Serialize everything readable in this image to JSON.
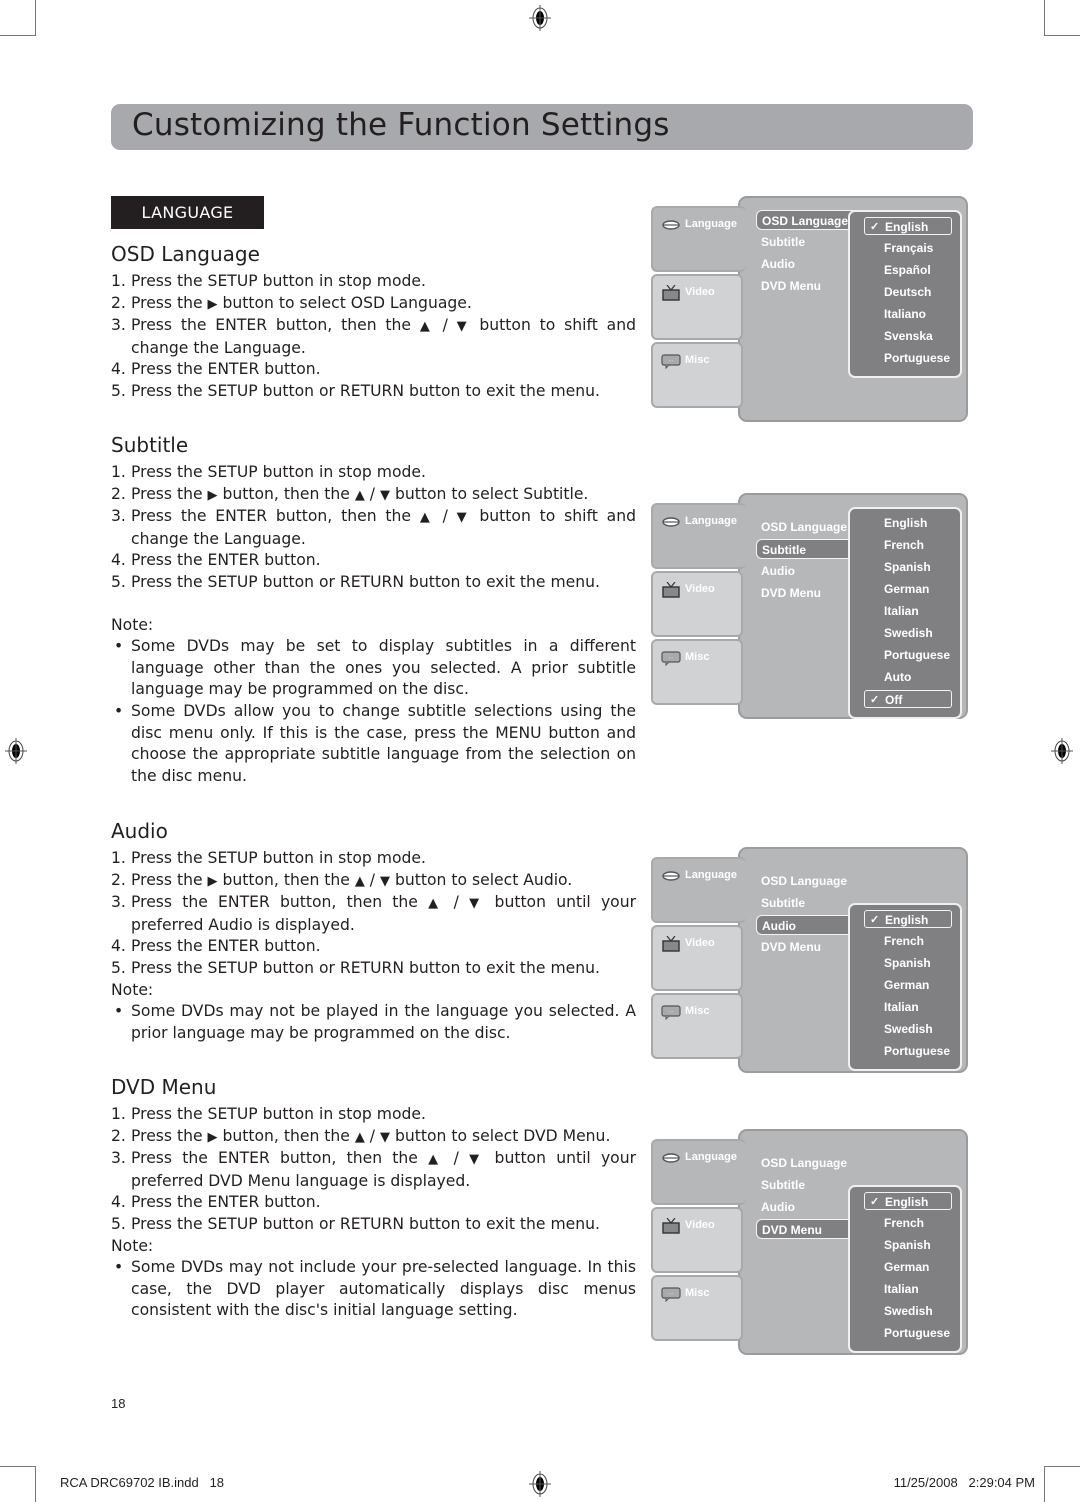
{
  "page": {
    "title": "Customizing the Function Settings",
    "section_tag": "LANGUAGE",
    "page_number": "18",
    "footer_file": "RCA DRC69702 IB.indd   18",
    "footer_timestamp": "11/25/2008   2:29:04 PM"
  },
  "symbols": {
    "right": "▶",
    "up": "▲",
    "down": "▼",
    "check": "✓"
  },
  "sections": {
    "osd": {
      "heading": "OSD Language",
      "steps": [
        {
          "n": "1.",
          "text": "Press the SETUP button in stop mode."
        },
        {
          "n": "2.",
          "pre": "Press the ",
          "post": " button to select OSD Language."
        },
        {
          "n": "3.",
          "pre": "Press the ENTER button, then the ",
          "mid": " / ",
          "post": " button to shift and change the Language."
        },
        {
          "n": "4.",
          "text": "Press the ENTER button."
        },
        {
          "n": "5.",
          "text": "Press the SETUP button or RETURN button to exit the menu."
        }
      ]
    },
    "subtitle": {
      "heading": "Subtitle",
      "steps": [
        {
          "n": "1.",
          "text": "Press the SETUP button in stop mode."
        },
        {
          "n": "2.",
          "pre": "Press the ",
          "mid1": " button, then the ",
          "mid2": " / ",
          "post": " button to select Subtitle."
        },
        {
          "n": "3.",
          "pre": "Press the ENTER button, then the ",
          "mid": " / ",
          "post": " button to shift and change the Language."
        },
        {
          "n": "4.",
          "text": "Press the ENTER button."
        },
        {
          "n": "5.",
          "text": "Press the SETUP button or RETURN button to exit the menu."
        }
      ],
      "note_label": "Note:",
      "notes": [
        "Some DVDs may be set to display subtitles in a different language other than the ones you selected. A prior subtitle language may be programmed on the disc.",
        "Some DVDs allow you to change subtitle selections using the disc menu only. If this is the case,  press the MENU button and choose the appropriate subtitle language from the selection on the disc menu."
      ]
    },
    "audio": {
      "heading": "Audio",
      "steps": [
        {
          "n": "1.",
          "text": "Press the SETUP button in stop mode."
        },
        {
          "n": "2.",
          "pre": "Press the ",
          "mid1": " button, then the ",
          "mid2": " / ",
          "post": " button to select Audio."
        },
        {
          "n": "3.",
          "pre": "Press the ENTER button, then the ",
          "mid": " / ",
          "post": " button until your preferred Audio is displayed."
        },
        {
          "n": "4.",
          "text": "Press the ENTER button."
        },
        {
          "n": "5.",
          "text": "Press the SETUP button or RETURN button to exit the menu."
        }
      ],
      "note_label": "Note:",
      "notes": [
        "Some DVDs may not be played in the language you selected. A prior language may be programmed on the disc."
      ]
    },
    "dvdmenu": {
      "heading": "DVD  Menu",
      "steps": [
        {
          "n": "1.",
          "text": "Press the SETUP button in stop mode."
        },
        {
          "n": "2.",
          "pre": "Press the ",
          "mid1": " button, then the ",
          "mid2": " / ",
          "post": " button to select DVD Menu."
        },
        {
          "n": "3.",
          "pre": "Press the ENTER button, then the ",
          "mid": " / ",
          "post": " button until your preferred DVD Menu language is displayed."
        },
        {
          "n": "4.",
          "text": "Press the ENTER button."
        },
        {
          "n": "5.",
          "text": "Press the SETUP button or RETURN button to exit the menu."
        }
      ],
      "note_label": "Note:",
      "notes": [
        "Some DVDs may not include your pre-selected language. In this case, the DVD player automatically displays disc menus consistent with the disc's initial language setting."
      ]
    }
  },
  "osd_tabs": [
    "Language",
    "Video",
    "Misc"
  ],
  "osd_menu_items": [
    "OSD Language",
    "Subtitle",
    "Audio",
    "DVD Menu"
  ],
  "osd_screens": [
    {
      "selected_item": "OSD Language",
      "options": [
        "English",
        "Français",
        "Español",
        "Deutsch",
        "Italiano",
        "Svenska",
        "Portuguese"
      ],
      "checked": "English"
    },
    {
      "selected_item": "Subtitle",
      "options": [
        "English",
        "French",
        "Spanish",
        "German",
        "Italian",
        "Swedish",
        "Portuguese",
        "Auto",
        "Off"
      ],
      "checked": "Off"
    },
    {
      "selected_item": "Audio",
      "options": [
        "English",
        "French",
        "Spanish",
        "German",
        "Italian",
        "Swedish",
        "Portuguese"
      ],
      "checked": "English"
    },
    {
      "selected_item": "DVD Menu",
      "options": [
        "English",
        "French",
        "Spanish",
        "German",
        "Italian",
        "Swedish",
        "Portuguese"
      ],
      "checked": "English"
    }
  ]
}
